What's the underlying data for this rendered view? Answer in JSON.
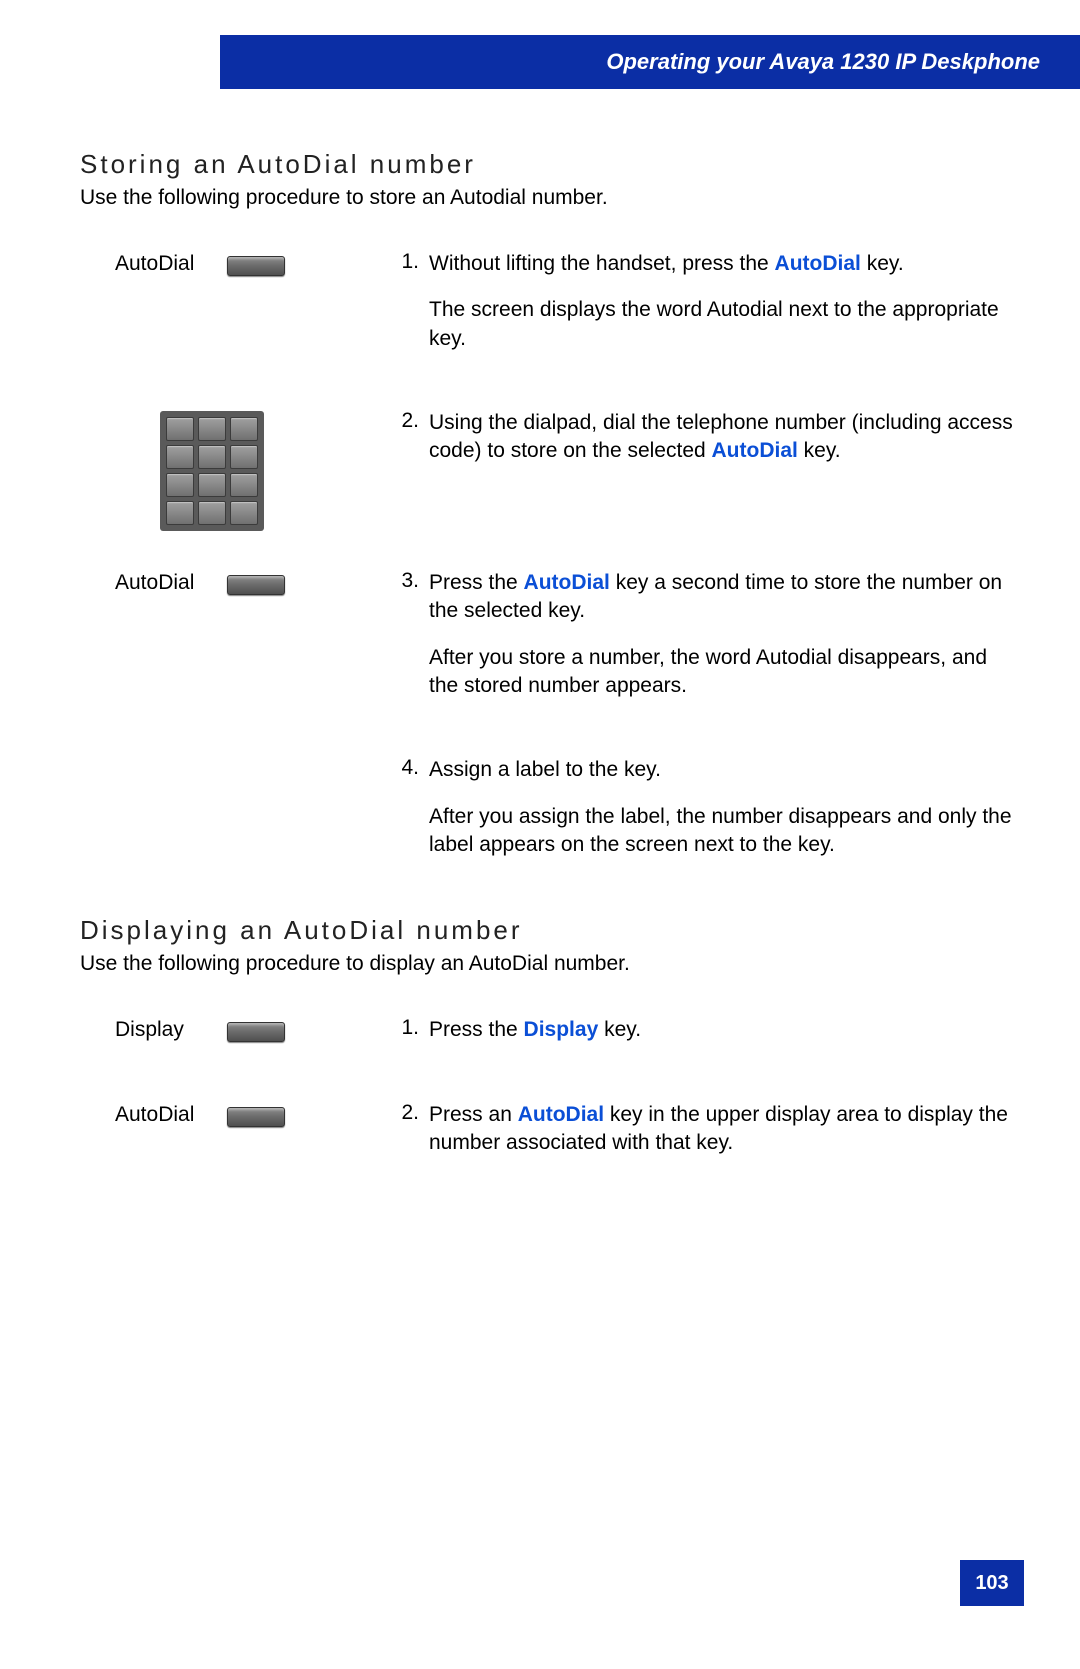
{
  "header": {
    "title": "Operating your Avaya 1230 IP Deskphone"
  },
  "section1": {
    "heading": "Storing an AutoDial number",
    "intro": "Use the following procedure to store an Autodial number."
  },
  "steps1": {
    "s1": {
      "label": "AutoDial",
      "num": "1.",
      "t1a": "Without lifting the handset, press the ",
      "kw1": "AutoDial",
      "t1b": " key.",
      "t2": "The screen displays the word Autodial next to the appropriate key."
    },
    "s2": {
      "num": "2.",
      "t1a": "Using the dialpad, dial the telephone number (including access code) to store on the selected ",
      "kw1": "AutoDial",
      "t1b": " key."
    },
    "s3": {
      "label": "AutoDial",
      "num": "3.",
      "t1a": "Press the ",
      "kw1": "AutoDial",
      "t1b": " key a second time to store the number on the selected key.",
      "t2": "After you store a number, the word Autodial disappears, and the stored number appears."
    },
    "s4": {
      "num": "4.",
      "t1": "Assign a label to the key.",
      "t2": "After you assign the label, the number disappears and only the label appears on the screen next to the key."
    }
  },
  "section2": {
    "heading": "Displaying an AutoDial number",
    "intro": "Use the following procedure to display an AutoDial number."
  },
  "steps2": {
    "s1": {
      "label": "Display",
      "num": "1.",
      "t1a": "Press the ",
      "kw1": "Display",
      "t1b": " key."
    },
    "s2": {
      "label": "AutoDial",
      "num": "2.",
      "t1a": "Press an ",
      "kw1": "AutoDial",
      "t1b": " key in the upper display area to display the number associated with that key."
    }
  },
  "pagenum": "103"
}
